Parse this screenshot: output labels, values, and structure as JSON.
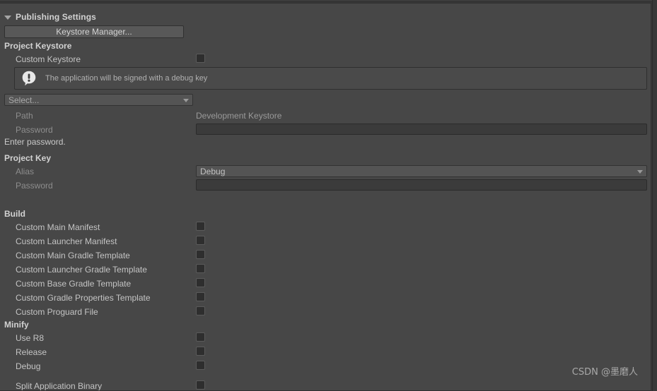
{
  "window": {
    "background_color": "#383838",
    "panel_color": "#474747"
  },
  "header": {
    "title": "Publishing Settings",
    "foldout_icon": "triangle-down-icon",
    "expanded": true
  },
  "toolbar": {
    "keystore_manager_label": "Keystore Manager..."
  },
  "project_keystore": {
    "group_label": "Project Keystore",
    "custom_keystore": {
      "label": "Custom Keystore",
      "checked": false
    },
    "help_box": {
      "icon": "warning-icon",
      "message": "The application will be signed with a debug key"
    },
    "keystore_select": {
      "value": "Select...",
      "arrow_icon": "chevron-down-icon"
    },
    "path": {
      "label": "Path",
      "value": "Development Keystore",
      "disabled": true
    },
    "password": {
      "label": "Password",
      "value": "",
      "disabled": true
    },
    "password_hint": "Enter password."
  },
  "project_key": {
    "group_label": "Project Key",
    "alias": {
      "label": "Alias",
      "value": "Debug",
      "arrow_icon": "chevron-down-icon",
      "disabled": true
    },
    "password": {
      "label": "Password",
      "value": "",
      "disabled": true
    }
  },
  "build": {
    "group_label": "Build",
    "items": [
      {
        "label": "Custom Main Manifest",
        "checked": false
      },
      {
        "label": "Custom Launcher Manifest",
        "checked": false
      },
      {
        "label": "Custom Main Gradle Template",
        "checked": false
      },
      {
        "label": "Custom Launcher Gradle Template",
        "checked": false
      },
      {
        "label": "Custom Base Gradle Template",
        "checked": false
      },
      {
        "label": "Custom Gradle Properties Template",
        "checked": false
      },
      {
        "label": "Custom Proguard File",
        "checked": false
      }
    ]
  },
  "minify": {
    "group_label": "Minify",
    "items": [
      {
        "label": "Use R8",
        "checked": false
      },
      {
        "label": "Release",
        "checked": false
      },
      {
        "label": "Debug",
        "checked": false
      }
    ]
  },
  "split_application_binary": {
    "label": "Split Application Binary",
    "checked": false
  },
  "watermark": {
    "text": "CSDN @墨磨人"
  }
}
